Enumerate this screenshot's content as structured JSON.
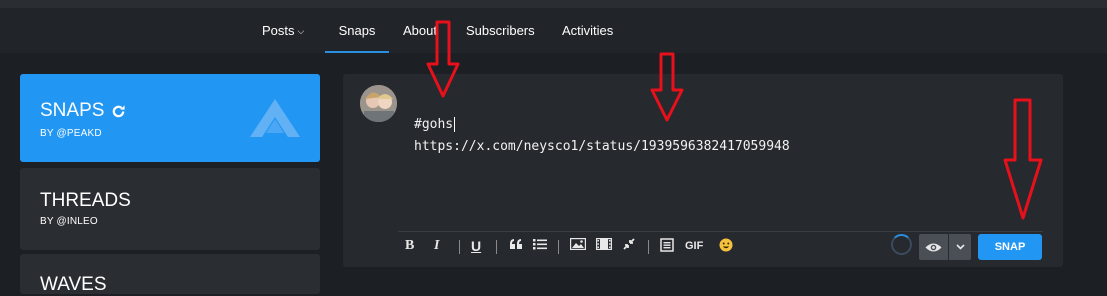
{
  "nav": {
    "items": [
      {
        "label": "Posts",
        "has_dropdown": true
      },
      {
        "label": "Snaps",
        "active": true
      },
      {
        "label": "About"
      },
      {
        "label": "Subscribers"
      },
      {
        "label": "Activities"
      }
    ]
  },
  "sidebar": {
    "cards": [
      {
        "title": "SNAPS",
        "subtitle": "BY @PEAKD",
        "active": true,
        "icon": "refresh-icon",
        "logo": "peakd-logo"
      },
      {
        "title": "THREADS",
        "subtitle": "BY @INLEO"
      },
      {
        "title": "WAVES"
      }
    ]
  },
  "editor": {
    "lines": [
      "#gohs",
      "https://x.com/neysco1/status/1939596382417059948"
    ],
    "toolbar": {
      "bold": "B",
      "italic": "I",
      "underline": "U",
      "gif": "GIF"
    },
    "submit_label": "SNAP"
  },
  "colors": {
    "accent": "#2196f3",
    "annotation_arrow": "#e8101a"
  }
}
